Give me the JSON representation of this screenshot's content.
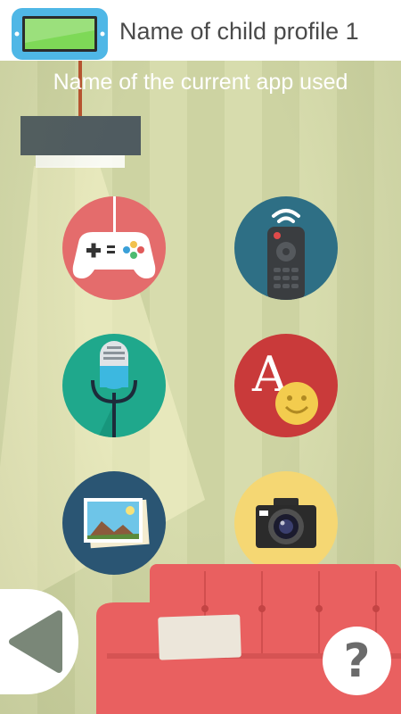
{
  "header": {
    "profile_name": "Name of child profile 1",
    "icon": "tablet-icon"
  },
  "current_app": "Name of the current app used",
  "apps": [
    {
      "icon": "gamepad-icon"
    },
    {
      "icon": "tv-remote-icon"
    },
    {
      "icon": "microphone-icon"
    },
    {
      "icon": "letters-smiley-icon"
    },
    {
      "icon": "photo-gallery-icon"
    },
    {
      "icon": "camera-icon"
    }
  ],
  "nav": {
    "back_icon": "back-arrow-icon",
    "help_label": "?"
  },
  "colors": {
    "wall_light": "#d7dcad",
    "wall_dark": "#cdd3a2",
    "sofa": "#e96060",
    "game": "#e46c6c",
    "remote": "#2e6f85",
    "mic": "#1fa88c",
    "abc": "#c93a3a",
    "photo": "#2a5573",
    "camera": "#f5d773"
  }
}
